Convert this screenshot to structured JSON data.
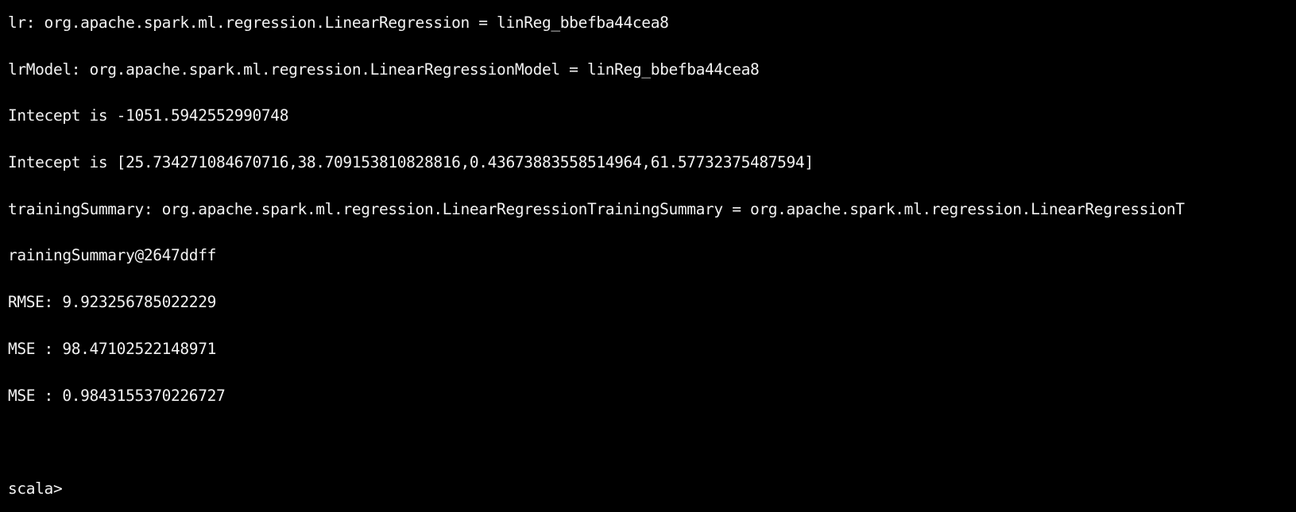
{
  "terminal": {
    "lines": [
      "lr: org.apache.spark.ml.regression.LinearRegression = linReg_bbefba44cea8",
      "lrModel: org.apache.spark.ml.regression.LinearRegressionModel = linReg_bbefba44cea8",
      "Intecept is -1051.5942552990748",
      "Intecept is [25.734271084670716,38.709153810828816,0.43673883558514964,61.57732375487594]",
      "trainingSummary: org.apache.spark.ml.regression.LinearRegressionTrainingSummary = org.apache.spark.ml.regression.LinearRegressionT",
      "rainingSummary@2647ddff",
      "RMSE: 9.923256785022229",
      "MSE : 98.47102522148971",
      "MSE : 0.9843155370226727"
    ],
    "prompt": "scala>"
  },
  "colors": {
    "background": "#000000",
    "foreground": "#f2f2f2"
  }
}
